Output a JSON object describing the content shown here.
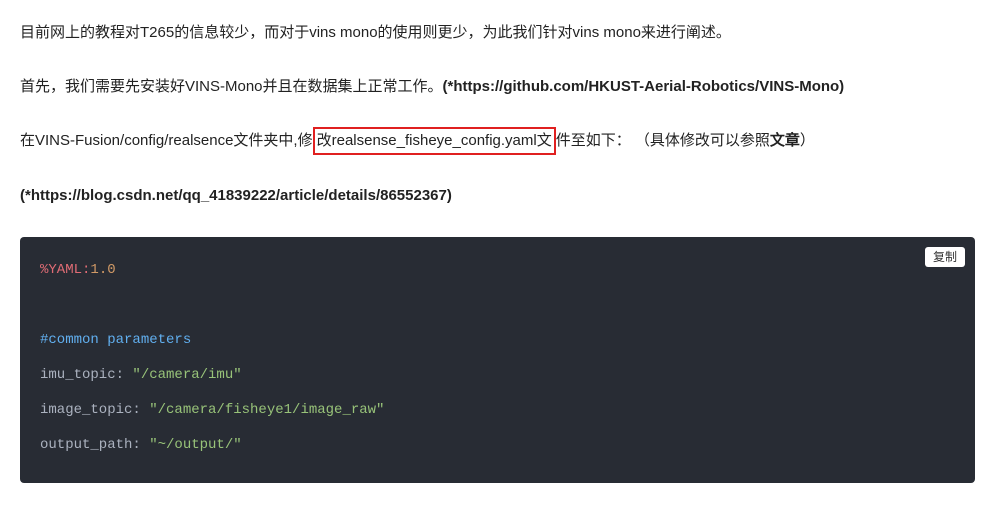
{
  "para1": "目前网上的教程对T265的信息较少，而对于vins mono的使用则更少，为此我们针对vins mono来进行阐述。",
  "para2_pre": "首先，我们需要先安装好VINS-Mono并且在数据集上正常工作。",
  "para2_link": "(*https://github.com/HKUST-Aerial-Robotics/VINS-Mono)",
  "para3_pre": "在VINS-Fusion/config/realsence文件夹中,修",
  "para3_hl": "改realsense_fisheye_config.yaml文",
  "para3_post": "件至如下：  （具体修改可以参照",
  "para3_bold": "文章",
  "para3_tail": "）",
  "para4": "(*https://blog.csdn.net/qq_41839222/article/details/86552367)",
  "copy_label": "复制",
  "code": {
    "l1_a": "%YAML:",
    "l1_b": "1.0",
    "l2": "#common parameters",
    "l3_k": "imu_topic: ",
    "l3_v": "\"/camera/imu\"",
    "l4_k": "image_topic: ",
    "l4_v": "\"/camera/fisheye1/image_raw\"",
    "l5_k": "output_path: ",
    "l5_v": "\"~/output/\""
  }
}
